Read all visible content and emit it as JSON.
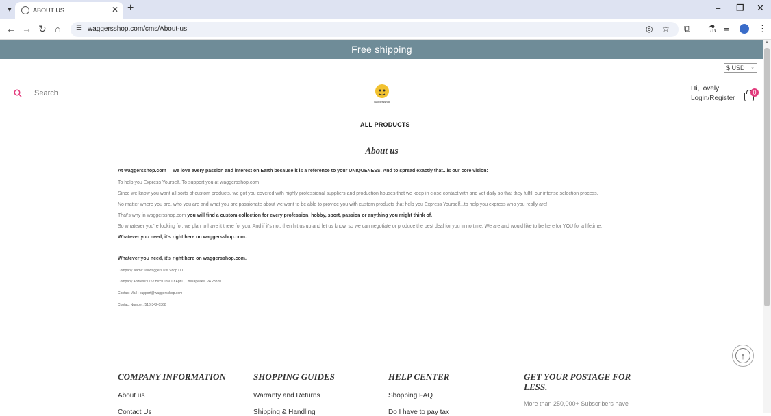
{
  "browser": {
    "tab_title": "ABOUT US",
    "url": "waggersshop.com/cms/About-us"
  },
  "banner": {
    "text": "Free shipping"
  },
  "currency": {
    "selected": "$ USD"
  },
  "search": {
    "placeholder": "Search"
  },
  "logo": {
    "text": "waggersshop"
  },
  "account": {
    "greeting": "Hi,Lovely",
    "login": "Login/Register",
    "cart_count": "0"
  },
  "nav": {
    "all_products": "ALL PRODUCTS"
  },
  "about": {
    "title": "About us",
    "intro_site": "At waggersshop.com",
    "intro_text": "we love every passion and interest on Earth because it is a reference to your UNIQUENESS. And to spread exactly that...is our core vision:",
    "p1": "To help you Express Yourself. To support you at waggersshop.com",
    "p2": "Since we know you want all sorts of custom products, we got you covered with highly professional suppliers and production houses that we keep in close contact with and vet daily so that they fulfill our intense selection process.",
    "p3": "No matter where you are, who you are and what you are passionate about we want to be able to provide you with custom products that help you Express Yourself...to help you express who you really are!",
    "p4_pre": "That's why in waggersshop.com",
    "p4_bold": "you will find a custom collection for every profession, hobby, sport, passion or anything you might think of.",
    "p5": "So whatever you're looking for, we plan to have it there for you. And if it's not, then hit us up and let us know, so we can negotiate or produce the best deal for you in no time. We are and would like to be here for YOU for a lifetime.",
    "p6": "Whatever you need, it's right here on waggersshop.com.",
    "p7": "Whatever you need, it's right here on waggersshop.com.",
    "company_name": "Company Name:TailWaggers Pet Shop LLC",
    "company_address": "Company Address:1752 Birch Trail Ct Apt L, Chesapeake, VA 23320",
    "contact_mail": "Contact Mail : support@waggersshop.com",
    "contact_number": "Contact Number:(516)342-0368"
  },
  "footer": {
    "col1": {
      "heading": "COMPANY INFORMATION",
      "links": [
        "About us",
        "Contact Us"
      ]
    },
    "col2": {
      "heading": "SHOPPING GUIDES",
      "links": [
        "Warranty and Returns",
        "Shipping & Handling"
      ]
    },
    "col3": {
      "heading": "HELP CENTER",
      "links": [
        "Shopping FAQ",
        "Do I have to pay tax"
      ]
    },
    "col4": {
      "heading_line1": "GET YOUR POSTAGE FOR",
      "heading_line2": "LESS.",
      "text": "More than 250,000+ Subscribers have"
    }
  },
  "colors": {
    "banner": "#6f8c98",
    "accent": "#e23a7c",
    "logo": "#f2c230"
  },
  "icons": [
    "chevron-down-icon",
    "globe-icon",
    "close-icon",
    "plus-icon",
    "back-icon",
    "forward-icon",
    "reload-icon",
    "home-icon",
    "site-info-icon",
    "eye-off-icon",
    "star-icon",
    "extensions-icon",
    "flask-icon",
    "media-icon",
    "profile-icon",
    "menu-icon",
    "search-icon",
    "cart-icon",
    "arrow-up-icon"
  ]
}
